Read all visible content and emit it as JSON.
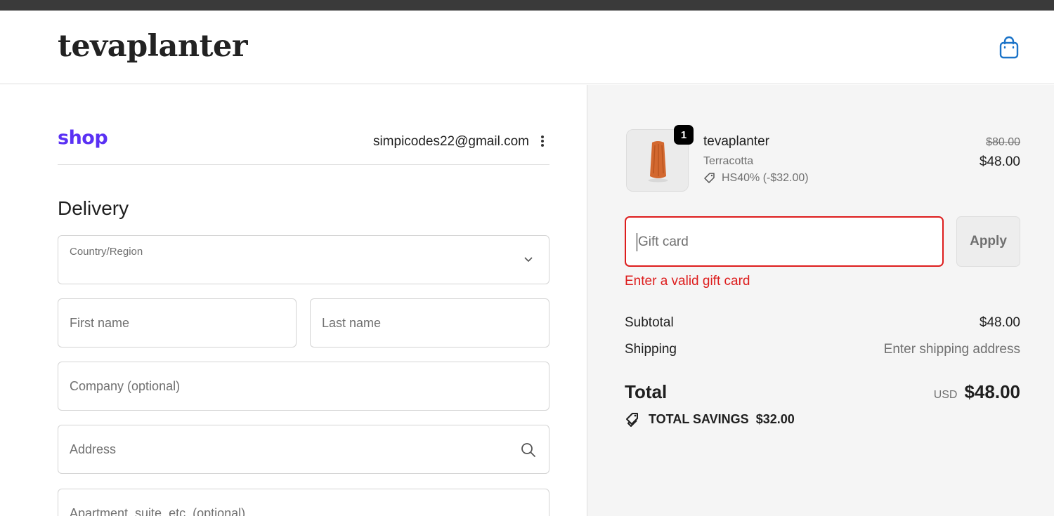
{
  "store": {
    "logo_text": "tevaplanter"
  },
  "account": {
    "provider_logo": "shop",
    "email": "simpicodes22@gmail.com"
  },
  "delivery": {
    "title": "Delivery",
    "country_label": "Country/Region",
    "first_name_placeholder": "First name",
    "last_name_placeholder": "Last name",
    "company_placeholder": "Company (optional)",
    "address_placeholder": "Address",
    "apartment_placeholder": "Apartment, suite, etc. (optional)"
  },
  "cart": {
    "quantity": "1",
    "product_name": "tevaplanter",
    "variant": "Terracotta",
    "discount": "HS40% (-$32.00)",
    "price_original": "$80.00",
    "price_current": "$48.00"
  },
  "gift_card": {
    "placeholder": "Gift card",
    "apply_label": "Apply",
    "error": "Enter a valid gift card"
  },
  "summary": {
    "subtotal_label": "Subtotal",
    "subtotal_value": "$48.00",
    "shipping_label": "Shipping",
    "shipping_value": "Enter shipping address",
    "total_label": "Total",
    "currency": "USD",
    "total_value": "$48.00",
    "savings_label": "TOTAL SAVINGS",
    "savings_value": "$32.00"
  },
  "icons": {
    "bag": "shopping-bag-icon",
    "kebab": "more-vertical-icon",
    "chevron": "chevron-down-icon",
    "search": "search-icon",
    "tag": "tag-icon",
    "savings": "savings-tag-icon"
  },
  "colors": {
    "shop_purple": "#5a31f4",
    "error_red": "#dd1d1d",
    "sidebar_bg": "#f5f5f5"
  }
}
